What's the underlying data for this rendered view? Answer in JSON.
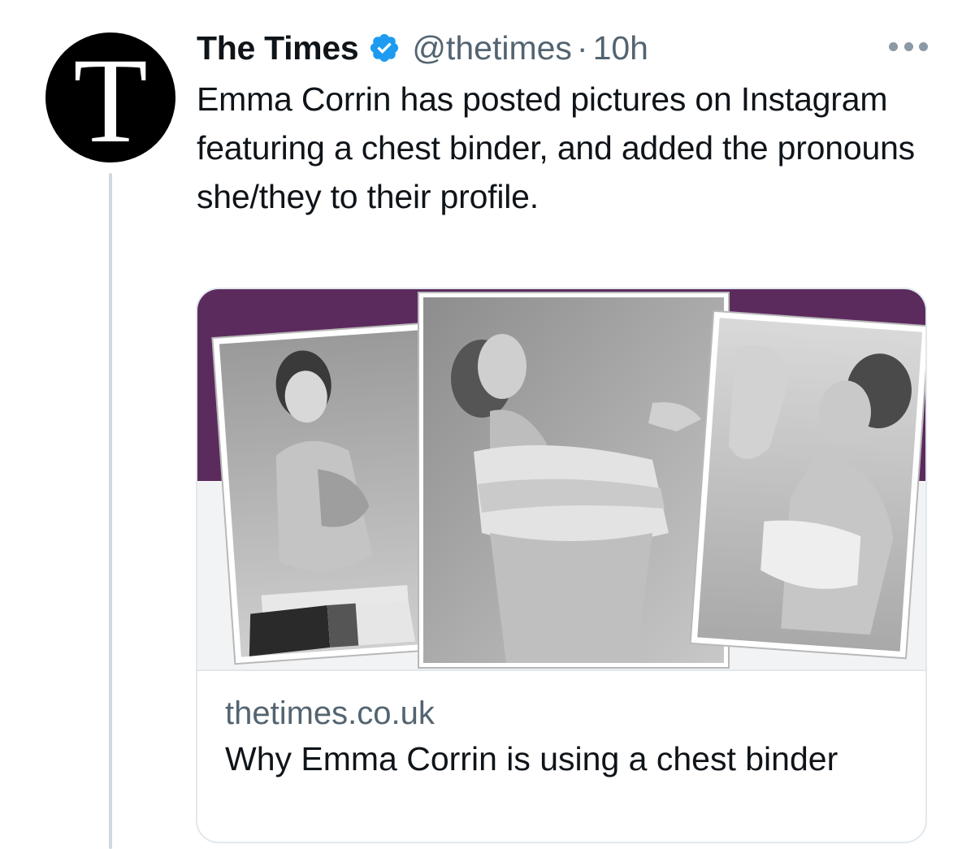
{
  "tweet": {
    "display_name": "The Times",
    "handle": "@thetimes",
    "separator": "·",
    "time": "10h",
    "text": "Emma Corrin has posted pictures on Instagram featuring a chest binder, and added the pronouns she/they to their profile.",
    "avatar_letter": "T",
    "verified_icon": "verified-badge-icon",
    "more_icon": "more-options-icon"
  },
  "card": {
    "domain": "thetimes.co.uk",
    "title": "Why Emma Corrin is using a chest binder",
    "image_icon": "photo-collage-three-black-and-white-portraits"
  },
  "colors": {
    "verified_blue": "#1d9bf0",
    "secondary_text": "#536471",
    "primary_text": "#0f1419",
    "card_band_purple": "#5c2b5e",
    "thread_line": "#cfd9de"
  }
}
